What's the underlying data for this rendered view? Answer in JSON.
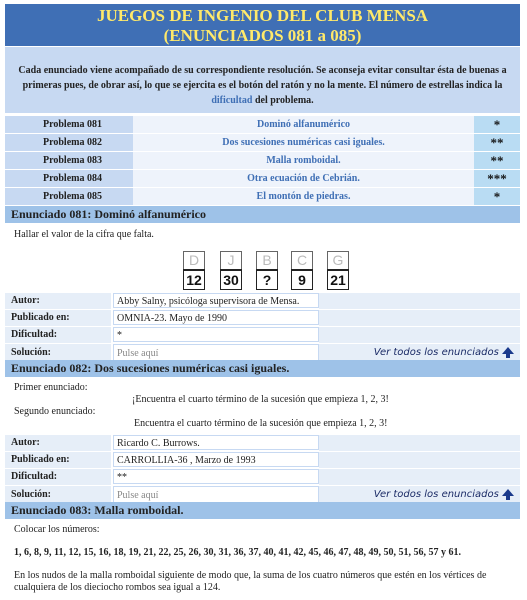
{
  "header": {
    "line1": "JUEGOS DE INGENIO DEL CLUB MENSA",
    "line2": "(ENUNCIADOS 081 a 085)"
  },
  "intro": {
    "text_before": "Cada enunciado viene acompañado de su correspondiente resolución. Se aconseja evitar consultar ésta de buenas a primeras pues, de obrar así, lo que se ejercita es el botón del ratón y no la mente. El número de estrellas indica la ",
    "link": "dificultad",
    "text_after": " del problema."
  },
  "problems": [
    {
      "num": "Problema 081",
      "title": "Dominó alfanumérico",
      "stars": "*"
    },
    {
      "num": "Problema 082",
      "title": "Dos sucesiones numéricas casi iguales.",
      "stars": "**"
    },
    {
      "num": "Problema 083",
      "title": "Malla romboidal.",
      "stars": "**"
    },
    {
      "num": "Problema 084",
      "title": "Otra ecuación de Cebrián.",
      "stars": "***"
    },
    {
      "num": "Problema 085",
      "title": "El montón de piedras.",
      "stars": "*"
    }
  ],
  "labels": {
    "autor": "Autor:",
    "publicado": "Publicado en:",
    "dificultad": "Dificultad:",
    "solucion": "Solución:",
    "solution_placeholder": "Pulse aquí",
    "see_all": "Ver todos los enunciados"
  },
  "e081": {
    "title": "Enunciado 081: Dominó alfanumérico",
    "text": "Hallar el valor de la cifra que falta.",
    "tiles": [
      {
        "top": "D",
        "bottom": "12"
      },
      {
        "top": "J",
        "bottom": "30"
      },
      {
        "top": "B",
        "bottom": "?"
      },
      {
        "top": "C",
        "bottom": "9"
      },
      {
        "top": "G",
        "bottom": "21"
      }
    ],
    "autor": "Abby Salny, psicóloga supervisora de Mensa.",
    "publicado": "OMNIA-23. Mayo de 1990",
    "dificultad": "*"
  },
  "e082": {
    "title": "Enunciado 082: Dos sucesiones numéricas casi iguales.",
    "first_label": "Primer enunciado:",
    "first_text": "¡Encuentra el cuarto término de la sucesión que empieza 1, 2, 3!",
    "second_label": "Segundo enunciado:",
    "second_text": "Encuentra el cuarto término de la sucesión que empieza 1, 2, 3!",
    "autor": "Ricardo C. Burrows.",
    "publicado": "CARROLLIA-36 , Marzo de 1993",
    "dificultad": "**"
  },
  "e083": {
    "title": "Enunciado 083: Malla romboidal.",
    "text1": "Colocar los números:",
    "numbers": "1, 6, 8, 9, 11, 12, 15, 16, 18, 19, 21, 22, 25, 26, 30, 31, 36, 37, 40, 41, 42, 45, 46, 47, 48, 49, 50, 51, 56, 57 y 61.",
    "text2": "En los nudos de la malla romboidal siguiente de modo que, la suma de los cuatro números que estén en los vértices de cualquiera de los dieciocho rombos sea igual a 124."
  }
}
